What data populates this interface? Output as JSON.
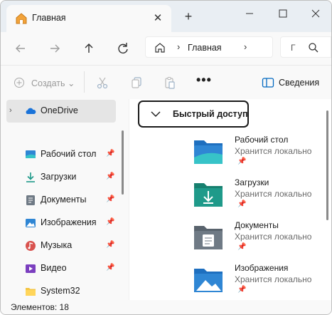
{
  "tab": {
    "title": "Главная",
    "close": "✕",
    "new_tab": "+"
  },
  "window_controls": {
    "minimize": "minimize-icon",
    "maximize": "maximize-icon",
    "close": "close-icon"
  },
  "address": {
    "crumb": "Главная",
    "search_hint": "Г"
  },
  "commands": {
    "create": "Создать",
    "details": "Сведения",
    "more": "•••"
  },
  "sidebar": {
    "onedrive": "OneDrive",
    "items": [
      {
        "label": "Рабочий стол",
        "icon": "desktop-icon",
        "pinned": true
      },
      {
        "label": "Загрузки",
        "icon": "downloads-icon",
        "pinned": true
      },
      {
        "label": "Документы",
        "icon": "documents-icon",
        "pinned": true
      },
      {
        "label": "Изображения",
        "icon": "pictures-icon",
        "pinned": true
      },
      {
        "label": "Музыка",
        "icon": "music-icon",
        "pinned": true
      },
      {
        "label": "Видео",
        "icon": "videos-icon",
        "pinned": true
      },
      {
        "label": "System32",
        "icon": "folder-icon",
        "pinned": false
      }
    ]
  },
  "quick_access": {
    "title": "Быстрый доступ",
    "items": [
      {
        "name": "Рабочий стол",
        "sub": "Хранится локально"
      },
      {
        "name": "Загрузки",
        "sub": "Хранится локально"
      },
      {
        "name": "Документы",
        "sub": "Хранится локально"
      },
      {
        "name": "Изображения",
        "sub": "Хранится локально"
      }
    ]
  },
  "status": {
    "text": "Элементов: 18"
  },
  "colors": {
    "accent": "#0067c0",
    "folder_blue": "#2f86d4",
    "folder_teal": "#1f9a8a",
    "folder_slate": "#6f7a85"
  }
}
